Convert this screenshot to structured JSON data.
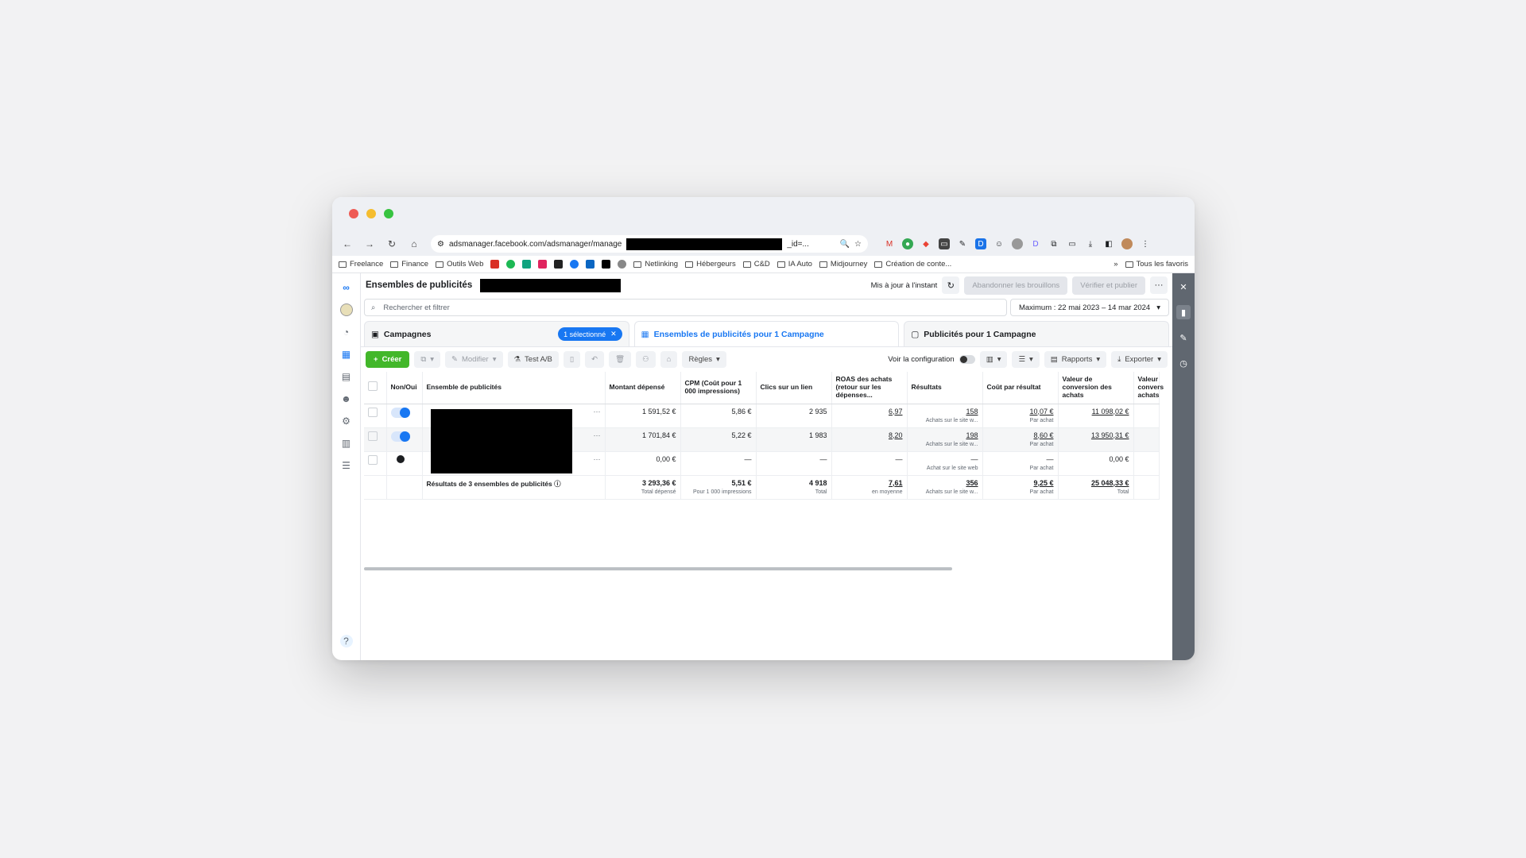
{
  "browser": {
    "url_prefix": "adsmanager.facebook.com/adsmanager/manage",
    "url_suffix": "_id=...",
    "bookmarks": [
      "Freelance",
      "Finance",
      "Outils Web",
      "Netlinking",
      "Hébergeurs",
      "C&D",
      "IA Auto",
      "Midjourney",
      "Création de conte...",
      "Tous les favoris"
    ]
  },
  "header": {
    "title": "Ensembles de publicités",
    "status": "Mis à jour à l'instant",
    "discard_label": "Abandonner les brouillons",
    "publish_label": "Vérifier et publier"
  },
  "search": {
    "placeholder": "Rechercher et filtrer",
    "date_range": "Maximum : 22 mai 2023 – 14 mar 2024"
  },
  "tabs": {
    "campaigns": "Campagnes",
    "selected_chip": "1 sélectionné",
    "adsets": "Ensembles de publicités pour 1 Campagne",
    "ads": "Publicités pour 1 Campagne"
  },
  "actions": {
    "create": "Créer",
    "modify": "Modifier",
    "ab_test": "Test A/B",
    "rules": "Règles",
    "view_config": "Voir la configuration",
    "reports": "Rapports",
    "export": "Exporter"
  },
  "table": {
    "headers": {
      "toggle": "Non/Oui",
      "name": "Ensemble de publicités",
      "spent": "Montant dépensé",
      "cpm": "CPM (Coût pour 1 000 impressions)",
      "clicks": "Clics sur un lien",
      "roas": "ROAS des achats (retour sur les dépenses...",
      "results": "Résultats",
      "cost_result": "Coût par résultat",
      "conv_value": "Valeur de conversion des achats",
      "conv_value2": "Valeur convers achats"
    },
    "rows": [
      {
        "spent": "1 591,52 €",
        "cpm": "5,86 €",
        "clicks": "2 935",
        "roas": "6,97",
        "results": "158",
        "results_sub": "Achats sur le site w...",
        "cost": "10,07 €",
        "cost_sub": "Par achat",
        "conv": "11 098,02 €"
      },
      {
        "spent": "1 701,84 €",
        "cpm": "5,22 €",
        "clicks": "1 983",
        "roas": "8,20",
        "results": "198",
        "results_sub": "Achats sur le site w...",
        "cost": "8,60 €",
        "cost_sub": "Par achat",
        "conv": "13 950,31 €"
      },
      {
        "spent": "0,00 €",
        "cpm": "—",
        "clicks": "—",
        "roas": "—",
        "results": "—",
        "results_sub": "Achat sur le site web",
        "cost": "—",
        "cost_sub": "Par achat",
        "conv": "0,00 €"
      }
    ],
    "totals": {
      "label": "Résultats de 3 ensembles de publicités",
      "spent": "3 293,36 €",
      "spent_sub": "Total dépensé",
      "cpm": "5,51 €",
      "cpm_sub": "Pour 1 000 impressions",
      "clicks": "4 918",
      "clicks_sub": "Total",
      "roas": "7,61",
      "roas_sub": "en moyenne",
      "results": "356",
      "results_sub": "Achats sur le site w...",
      "cost": "9,25 €",
      "cost_sub": "Par achat",
      "conv": "25 048,33 €",
      "conv_sub": "Total"
    }
  }
}
